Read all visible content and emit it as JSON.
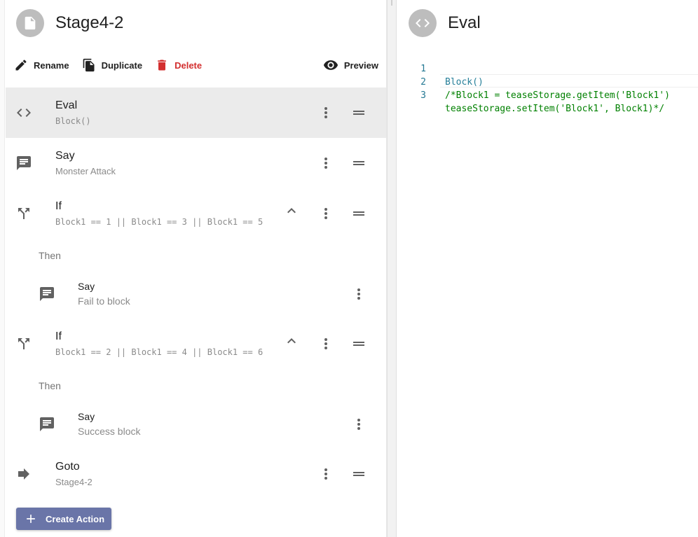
{
  "page": {
    "title": "Stage4-2"
  },
  "toolbar": {
    "rename_label": "Rename",
    "duplicate_label": "Duplicate",
    "delete_label": "Delete",
    "preview_label": "Preview"
  },
  "actions": [
    {
      "type": "Eval",
      "detail": "Block()",
      "icon": "code-icon",
      "selected": true
    },
    {
      "type": "Say",
      "detail": "Monster Attack",
      "icon": "comment-icon"
    },
    {
      "type": "If",
      "detail": "Block1 == 1 || Block1 == 3 || Block1 == 5",
      "icon": "branch-icon",
      "then_label": "Then",
      "children": [
        {
          "type": "Say",
          "detail": "Fail to block",
          "icon": "comment-icon"
        }
      ]
    },
    {
      "type": "If",
      "detail": "Block1 == 2 || Block1 == 4 || Block1 == 6",
      "icon": "branch-icon",
      "then_label": "Then",
      "children": [
        {
          "type": "Say",
          "detail": "Success block",
          "icon": "comment-icon"
        }
      ]
    },
    {
      "type": "Goto",
      "detail": "Stage4-2",
      "icon": "arrow-right-icon"
    }
  ],
  "create_action_label": "Create Action",
  "editor": {
    "title": "Eval",
    "lines": [
      {
        "number": "1",
        "text": "Block()",
        "kind": "default"
      },
      {
        "number": "2",
        "text": "/*Block1 = teaseStorage.getItem('Block1')",
        "kind": "comment"
      },
      {
        "number": "3",
        "text": "teaseStorage.setItem('Block1', Block1)*/",
        "kind": "comment"
      }
    ]
  },
  "colors": {
    "accent": "#6a75a8",
    "danger": "#d32f2f",
    "selected_row": "#ebebeb",
    "comment": "#008000",
    "line_number": "#237893"
  }
}
